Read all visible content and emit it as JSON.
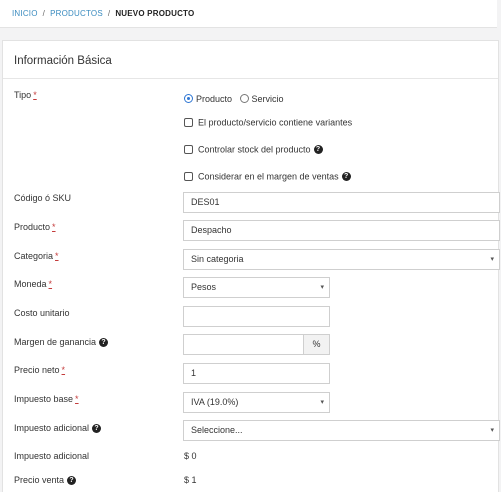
{
  "breadcrumb": {
    "items": [
      "INICIO",
      "PRODUCTOS"
    ],
    "separator": "/",
    "current": "NUEVO PRODUCTO"
  },
  "panel": {
    "title": "Información Básica"
  },
  "required_mark": "*",
  "help_icon_glyph": "?",
  "form": {
    "tipo": {
      "label": "Tipo",
      "options": [
        "Producto",
        "Servicio"
      ],
      "selected": "Producto"
    },
    "checkboxes": [
      {
        "label": "El producto/servicio contiene variantes",
        "checked": false,
        "help": false
      },
      {
        "label": "Controlar stock del producto",
        "checked": false,
        "help": true
      },
      {
        "label": "Considerar en el margen de ventas",
        "checked": false,
        "help": true
      }
    ],
    "sku": {
      "label": "Código ó SKU",
      "value": "DES01"
    },
    "producto": {
      "label": "Producto",
      "value": "Despacho"
    },
    "categoria": {
      "label": "Categoria",
      "value": "Sin categoria"
    },
    "moneda": {
      "label": "Moneda",
      "value": "Pesos"
    },
    "costo_unitario": {
      "label": "Costo unitario",
      "value": ""
    },
    "margen": {
      "label": "Margen de ganancia",
      "value": "",
      "addon": "%"
    },
    "precio_neto": {
      "label": "Precio neto",
      "value": "1"
    },
    "impuesto_base": {
      "label": "Impuesto base",
      "value": "IVA (19.0%)"
    },
    "impuesto_adicional_select": {
      "label": "Impuesto adicional",
      "value": "Seleccione..."
    },
    "impuesto_adicional_total": {
      "label": "Impuesto adicional",
      "value": "$ 0"
    },
    "precio_venta": {
      "label": "Precio venta",
      "value": "$ 1"
    }
  },
  "colors": {
    "link": "#3a8bbf",
    "required": "#c43b3b",
    "radio_selected": "#2e76d3",
    "page_background": "#f3f3f4"
  },
  "icons": {
    "dropdown": "caret-down-icon",
    "help": "question-circle-icon"
  }
}
